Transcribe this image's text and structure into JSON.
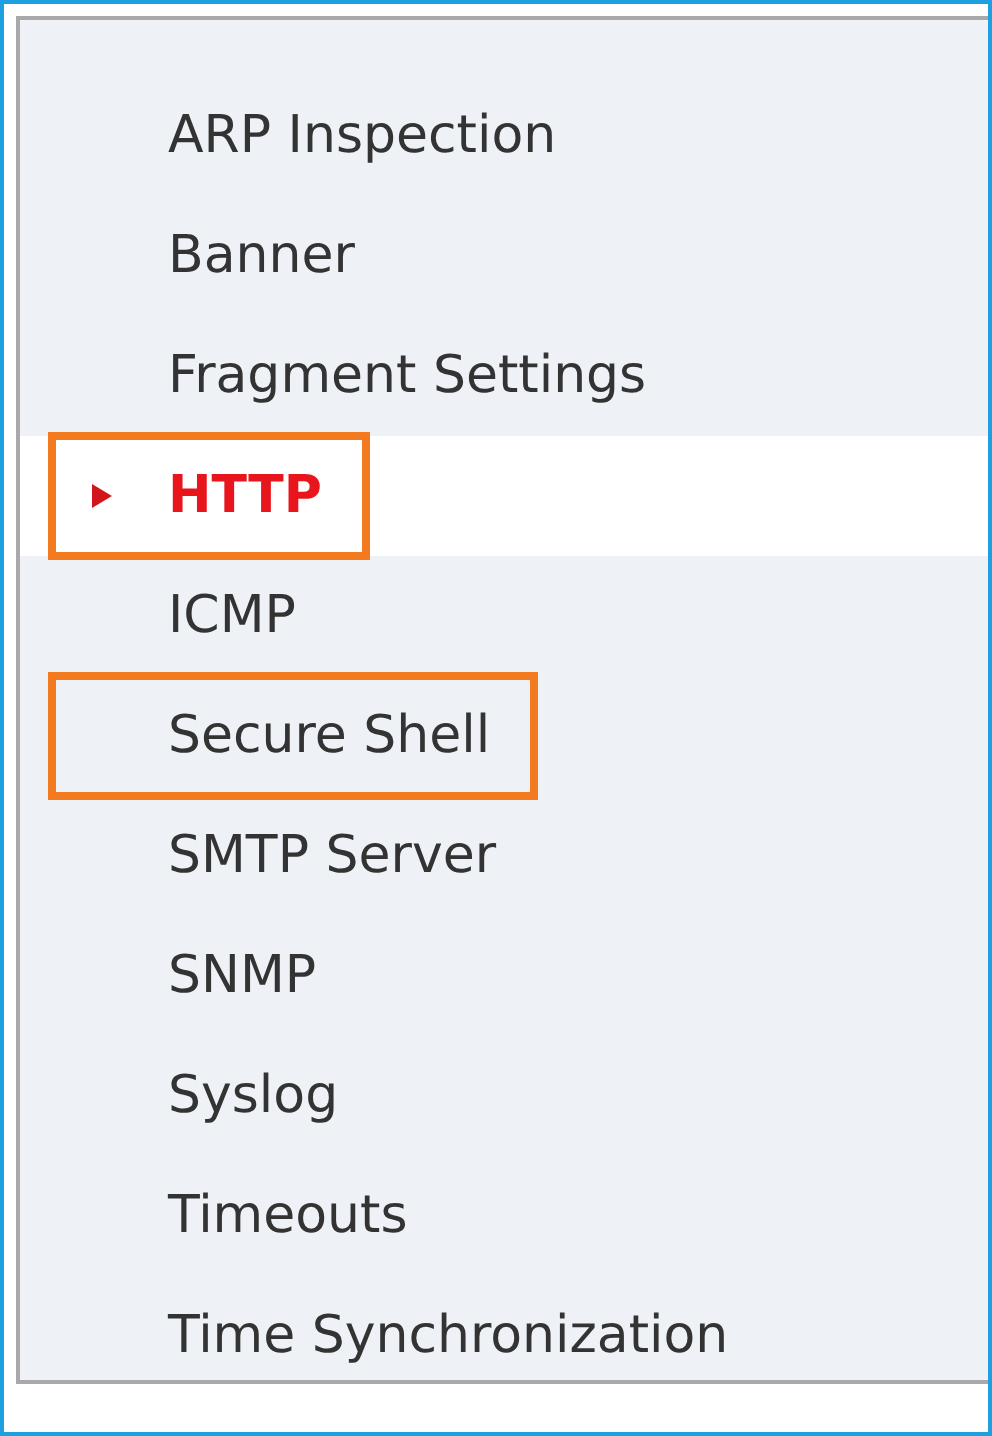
{
  "menu": {
    "items": [
      {
        "label": "ARP Inspection",
        "selected": false,
        "highlighted": false
      },
      {
        "label": "Banner",
        "selected": false,
        "highlighted": false
      },
      {
        "label": "Fragment Settings",
        "selected": false,
        "highlighted": false
      },
      {
        "label": "HTTP",
        "selected": true,
        "highlighted": true
      },
      {
        "label": "ICMP",
        "selected": false,
        "highlighted": false
      },
      {
        "label": "Secure Shell",
        "selected": false,
        "highlighted": true
      },
      {
        "label": "SMTP Server",
        "selected": false,
        "highlighted": false
      },
      {
        "label": "SNMP",
        "selected": false,
        "highlighted": false
      },
      {
        "label": "Syslog",
        "selected": false,
        "highlighted": false
      },
      {
        "label": "Timeouts",
        "selected": false,
        "highlighted": false
      },
      {
        "label": "Time Synchronization",
        "selected": false,
        "highlighted": false
      }
    ]
  }
}
